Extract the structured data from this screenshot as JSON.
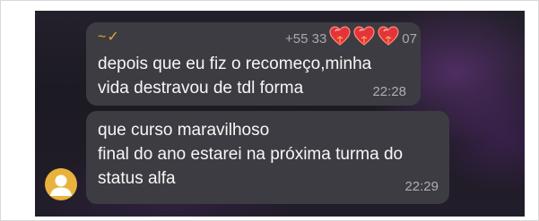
{
  "messages": [
    {
      "sender": "~✓",
      "phone_prefix": "+55 33",
      "phone_suffix": "07",
      "hearts": [
        "heart-icon",
        "heart-icon",
        "heart-icon"
      ],
      "text": "depois que eu fiz o recomeço,minha\nvida destravou de tdl forma",
      "time": "22:28"
    },
    {
      "text": "que curso maravilhoso\nfinal do ano estarei na próxima turma do\nstatus alfa",
      "time": "22:29"
    }
  ],
  "avatar": {
    "icon": "user-avatar-icon"
  },
  "colors": {
    "bubble": "#3d3c42",
    "sender": "#e3a72f",
    "avatar": "#e8b23c",
    "heart": "#e3343c",
    "background": "#1f1c25"
  }
}
